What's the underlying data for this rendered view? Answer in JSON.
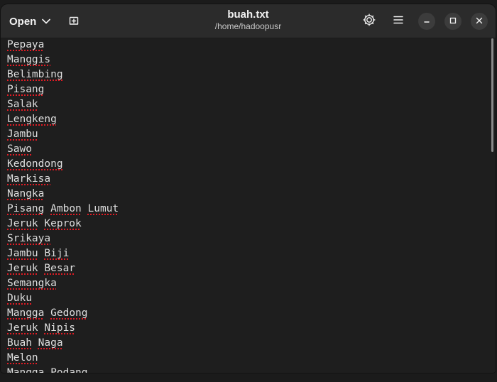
{
  "header": {
    "open_label": "Open",
    "title": "buah.txt",
    "subtitle": "/home/hadoopusr",
    "icons": [
      "new-tab-icon",
      "settings-icon",
      "menu-icon",
      "minimize-icon",
      "maximize-icon",
      "close-icon"
    ]
  },
  "editor": {
    "lines": [
      "Pepaya",
      "Manggis",
      "Belimbing",
      "Pisang",
      "Salak",
      "Lengkeng",
      "Jambu",
      "Sawo",
      "Kedondong",
      "Markisa",
      "Nangka",
      "Pisang Ambon Lumut",
      "Jeruk Keprok",
      "Srikaya",
      "Jambu Biji",
      "Jeruk Besar",
      "Semangka",
      "Duku",
      "Mangga Gedong",
      "Jeruk Nipis",
      "Buah Naga",
      "Melon",
      "Mangga Podang"
    ]
  },
  "colors": {
    "background": "#1e1e1e",
    "headerbar": "#2b2b2b",
    "text": "#dedede",
    "spellcheck_underline": "#e01b24"
  }
}
